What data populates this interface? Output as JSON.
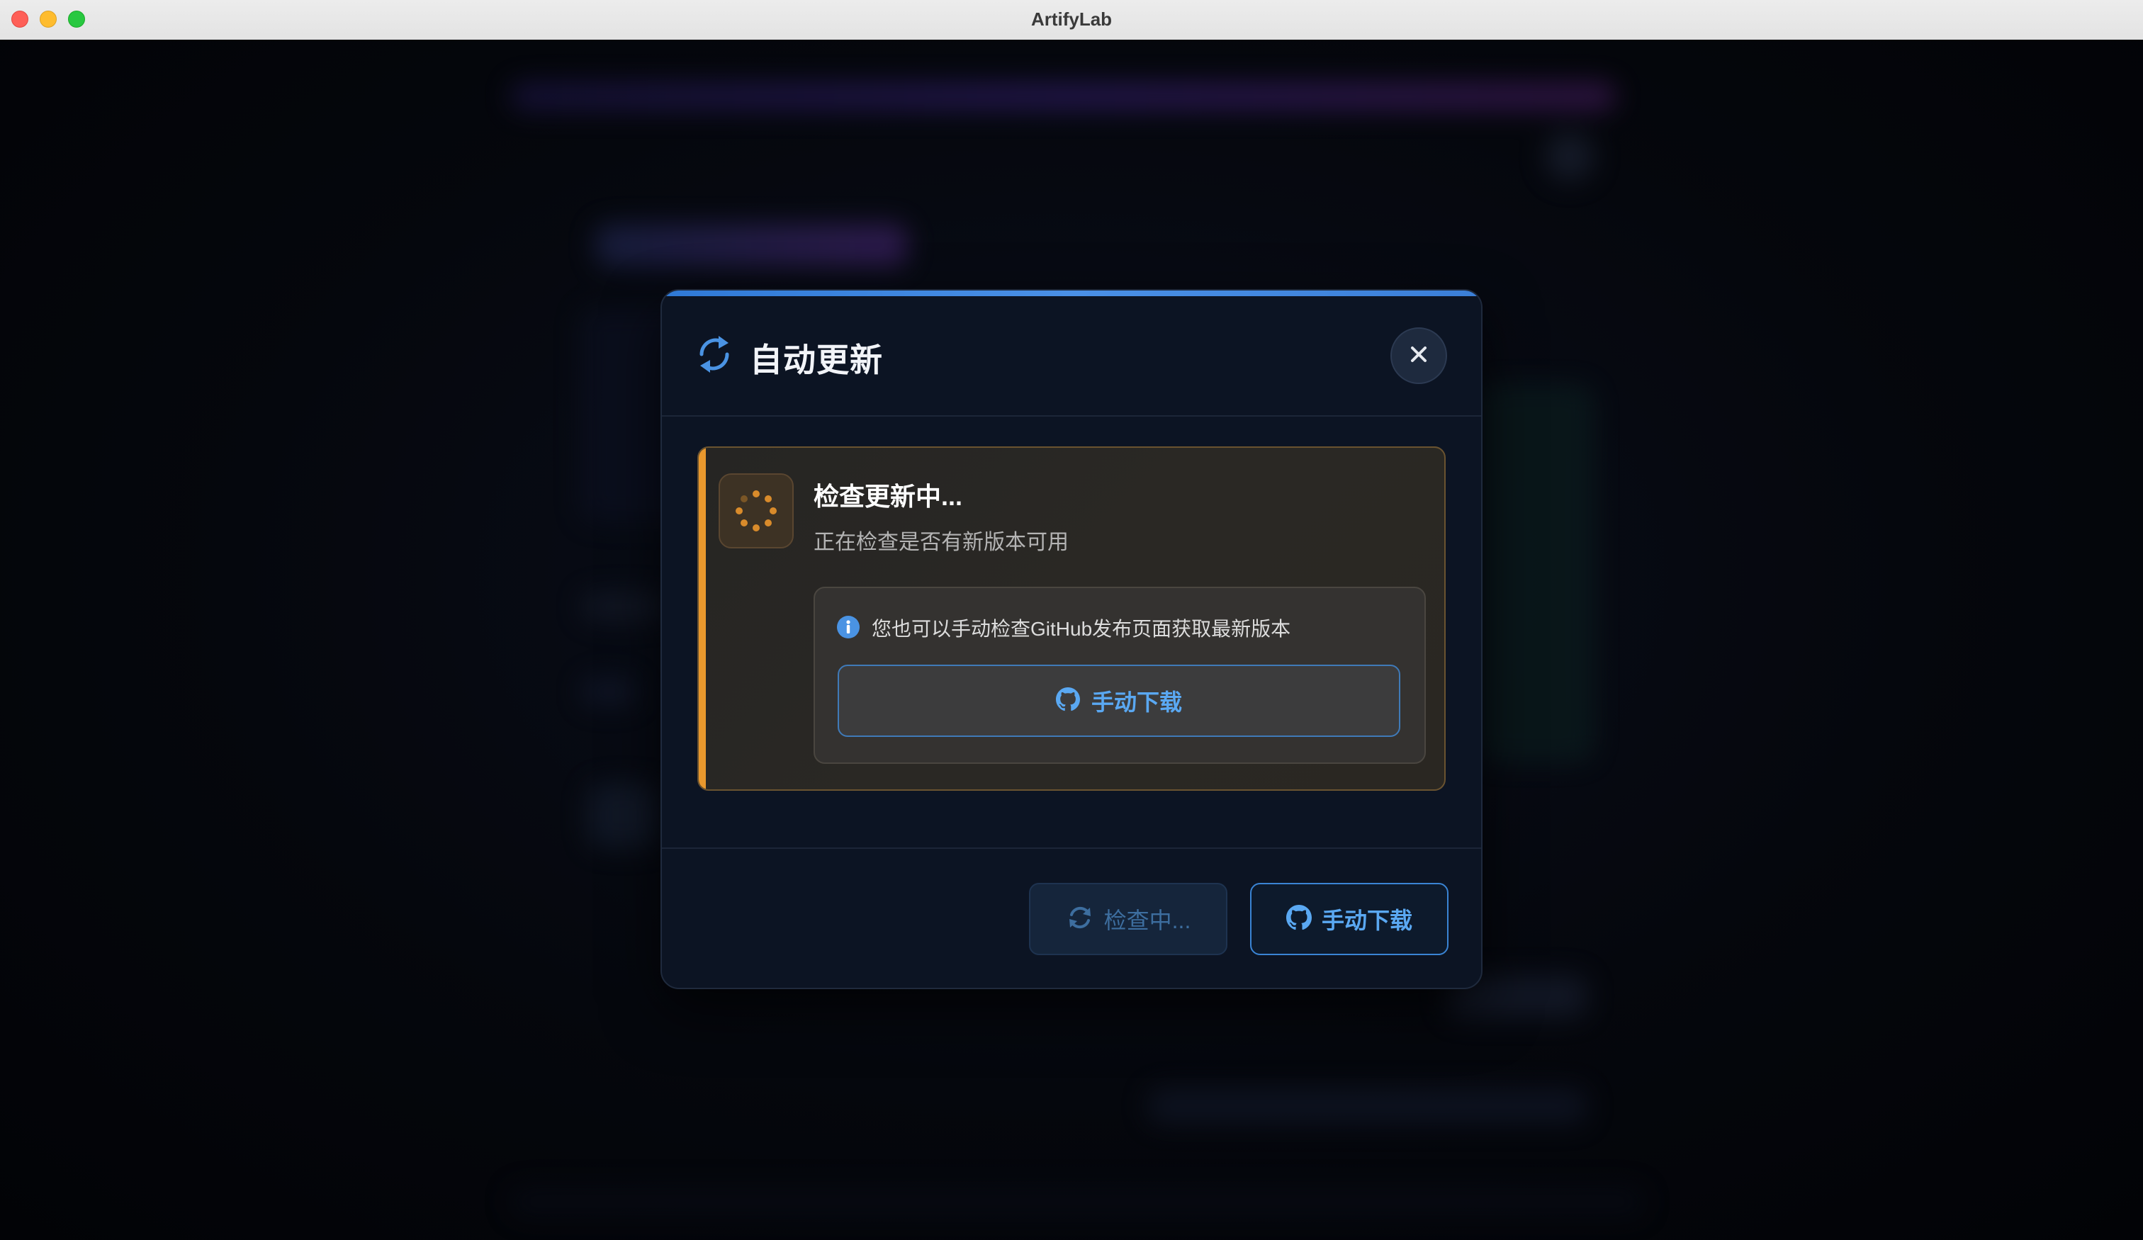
{
  "window": {
    "title": "ArtifyLab"
  },
  "dialog": {
    "title": "自动更新",
    "header_icon": "sync-icon",
    "close_icon": "close-icon",
    "accent_color": "#3b7fd8"
  },
  "status": {
    "title": "检查更新中...",
    "description": "正在检查是否有新版本可用",
    "icon": "loading-spinner-icon",
    "accent_color": "#e9982d",
    "info_icon": "info-icon",
    "info_text": "您也可以手动检查GitHub发布页面获取最新版本",
    "manual_download_label": "手动下载",
    "manual_download_icon": "github-icon"
  },
  "footer": {
    "check_label": "检查中...",
    "check_icon": "refresh-icon",
    "download_label": "手动下载",
    "download_icon": "github-icon"
  }
}
